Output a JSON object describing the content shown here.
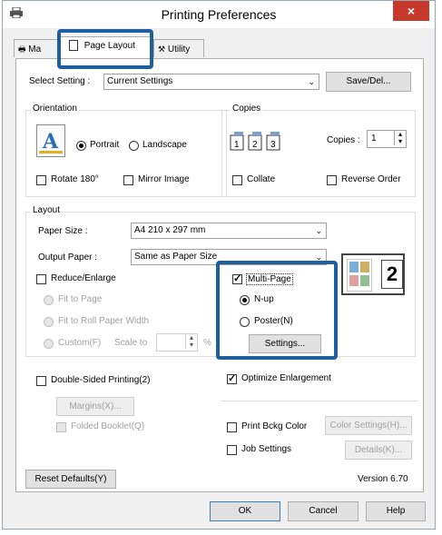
{
  "window": {
    "title": "Printing Preferences",
    "close": "×"
  },
  "tabs": [
    {
      "label": "Ma"
    },
    {
      "label": "Page Layout"
    },
    {
      "label": "Utility"
    }
  ],
  "select_setting": {
    "label": "Select Setting :",
    "value": "Current Settings",
    "save_button": "Save/Del..."
  },
  "orientation": {
    "title": "Orientation",
    "portrait": "Portrait",
    "landscape": "Landscape",
    "rotate180": "Rotate 180°",
    "mirror": "Mirror Image",
    "selected": "Portrait"
  },
  "copies": {
    "title": "Copies",
    "label": "Copies :",
    "value": "1",
    "collate": "Collate",
    "reverse": "Reverse Order"
  },
  "layout": {
    "title": "Layout",
    "paper_size_label": "Paper Size :",
    "paper_size_value": "A4 210 x 297 mm",
    "output_paper_label": "Output Paper :",
    "output_paper_value": "Same as Paper Size",
    "reduce_enlarge": "Reduce/Enlarge",
    "fit_to_page": "Fit to Page",
    "fit_to_roll": "Fit to Roll Paper Width",
    "custom": "Custom(F)",
    "scale_to": "Scale to",
    "percent": "%",
    "multipage": "Multi-Page",
    "nup": "N-up",
    "poster": "Poster(N)",
    "settings_button": "Settings...",
    "preview_number": "2"
  },
  "double_sided": {
    "label": "Double-Sided Printing(2)",
    "margins_button": "Margins(X)...",
    "folded_booklet": "Folded Booklet(Q)"
  },
  "optimize": "Optimize Enlargement",
  "print_bkg": "Print Bckg Color",
  "color_settings_button": "Color Settings(H)...",
  "job_settings": "Job Settings",
  "details_button": "Details(K)...",
  "reset_button": "Reset Defaults(Y)",
  "version": "Version 6.70",
  "footer": {
    "ok": "OK",
    "cancel": "Cancel",
    "help": "Help"
  },
  "colors": {
    "highlight": "#1f5fa0",
    "close": "#c7392b"
  }
}
